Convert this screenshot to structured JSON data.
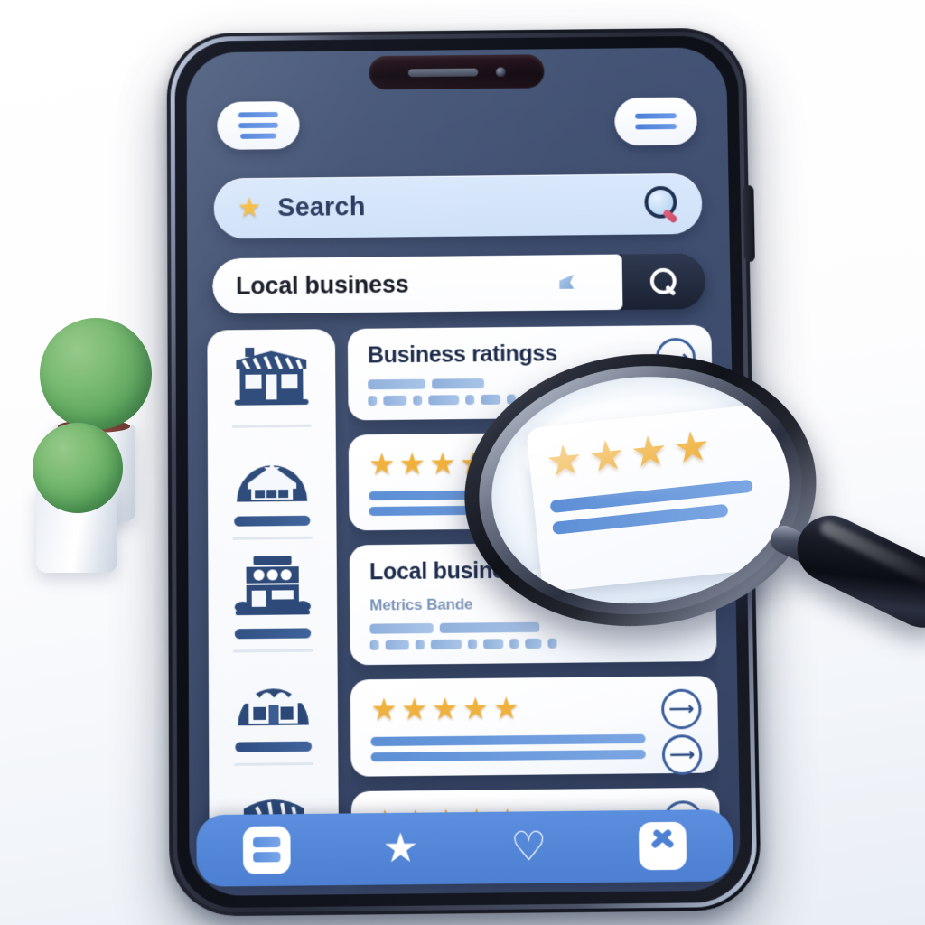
{
  "scene": {
    "background_color": "#ffffff",
    "device": "smartphone",
    "props": [
      "potted-plant-large",
      "potted-plant-small",
      "magnifying-glass"
    ]
  },
  "phone": {
    "bezel_color": "#15171f",
    "screen_bg_color": "#3f4e70"
  },
  "header": {
    "left_menu_label": "menu",
    "right_menu_label": "options"
  },
  "search_pill": {
    "star_icon": "star-icon",
    "label": "Search",
    "magnifier_icon": "magnifier-icon"
  },
  "search_input": {
    "value": "Local business",
    "placeholder": "Local business",
    "button_icon": "search-icon"
  },
  "sidebar": {
    "items": [
      {
        "icon": "storefront-icon",
        "label": ""
      },
      {
        "icon": "shop-awning-star-icon",
        "label": ""
      },
      {
        "icon": "store-building-icon",
        "label": ""
      },
      {
        "icon": "market-stall-icon",
        "label": ""
      },
      {
        "icon": "kiosk-icon",
        "label": ""
      }
    ]
  },
  "cards": [
    {
      "title": "Business ratingss",
      "subtitle": "",
      "stars": 0,
      "lines": 0,
      "chips": [
        64,
        58
      ],
      "chips2": [
        10,
        26,
        10,
        34,
        10,
        22,
        10,
        18,
        10
      ],
      "badge": "arrow-badge"
    },
    {
      "title": "",
      "subtitle": "",
      "stars": 5,
      "lines": 2,
      "chips": [],
      "chips2": [],
      "badge": ""
    },
    {
      "title": "Local busine",
      "subtitle": "Metrics Bande",
      "stars": 0,
      "lines": 0,
      "chips": [
        70,
        110
      ],
      "chips2": [
        10,
        26,
        10,
        34,
        10,
        22,
        10,
        18,
        10
      ],
      "badge": ""
    },
    {
      "title": "",
      "subtitle": "",
      "stars": 5,
      "lines": 2,
      "chips": [],
      "chips2": [],
      "badge": "arrow-badge"
    },
    {
      "title": "",
      "subtitle": "",
      "stars": 5,
      "lines": 0,
      "chips": [],
      "chips2": [],
      "badge": "arrow-badge"
    }
  ],
  "bottom_nav": {
    "items": [
      {
        "icon": "cards-list-icon",
        "label": ""
      },
      {
        "icon": "star-icon",
        "label": ""
      },
      {
        "icon": "heart-icon",
        "label": ""
      },
      {
        "icon": "chevron-up-icon",
        "label": ""
      }
    ],
    "bar_color": "#4f81d4"
  },
  "magnifier": {
    "magnified_stars": 4,
    "magnified_lines": 2,
    "rim_color": "#15171f",
    "handle_color": "#0b0d14"
  },
  "colors": {
    "accent_blue": "#4d7fd2",
    "star_gold": "#f0b13c",
    "screen_navy": "#3f4e70",
    "text_dark": "#1d2b4a",
    "plant_green": "#5aa45c"
  }
}
